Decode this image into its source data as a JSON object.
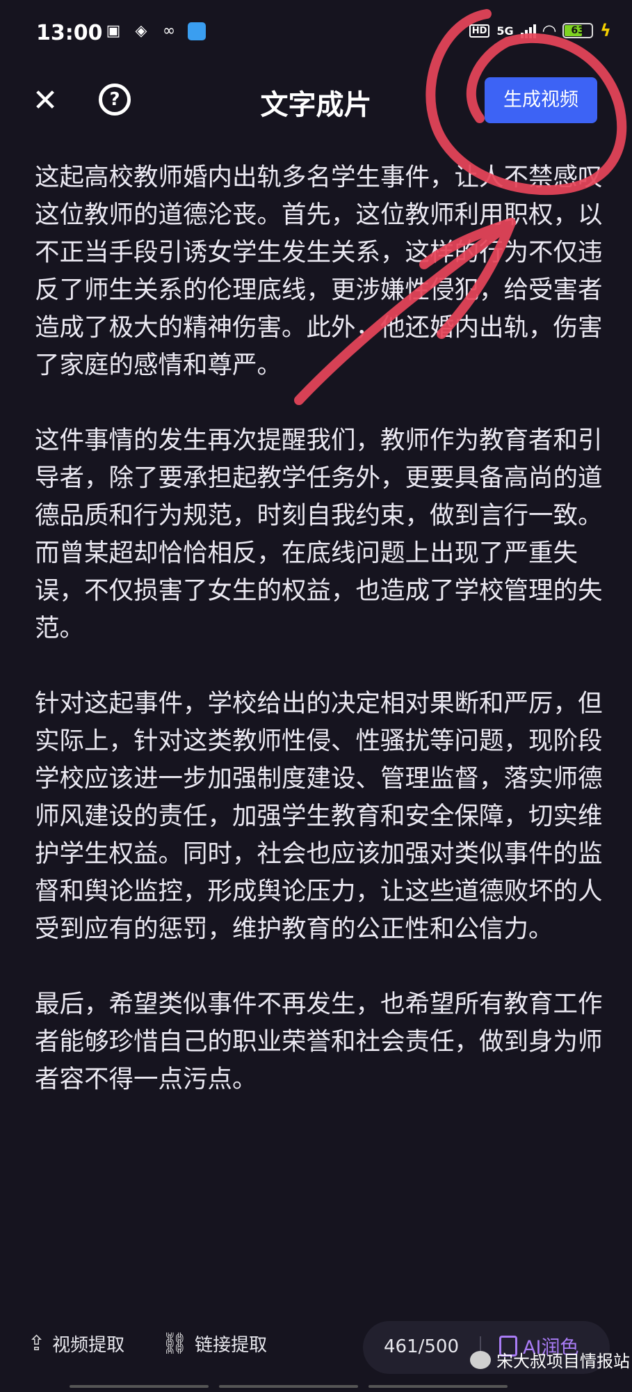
{
  "status_bar": {
    "time": "13:00",
    "network": "5G",
    "battery": "63",
    "icons": [
      "tv-icon",
      "cloud-app-icon",
      "butterfly-icon",
      "wallet-icon",
      "hd-icon",
      "signal-icon",
      "wifi-icon",
      "battery-icon",
      "charging-icon"
    ]
  },
  "header": {
    "close_icon": "close-icon",
    "help_icon": "help-circle-icon",
    "title": "文字成片",
    "generate_button": "生成视频"
  },
  "content": {
    "paragraphs": [
      "这起高校教师婚内出轨多名学生事件，让人不禁感叹这位教师的道德沦丧。首先，这位教师利用职权，以不正当手段引诱女学生发生关系，这样的行为不仅违反了师生关系的伦理底线，更涉嫌性侵犯，给受害者造成了极大的精神伤害。此外，他还婚内出轨，伤害了家庭的感情和尊严。",
      "这件事情的发生再次提醒我们，教师作为教育者和引导者，除了要承担起教学任务外，更要具备高尚的道德品质和行为规范，时刻自我约束，做到言行一致。而曾某超却恰恰相反，在底线问题上出现了严重失误，不仅损害了女生的权益，也造成了学校管理的失范。",
      "针对这起事件，学校给出的决定相对果断和严厉，但实际上，针对这类教师性侵、性骚扰等问题，现阶段学校应该进一步加强制度建设、管理监督，落实师德师风建设的责任，加强学生教育和安全保障，切实维护学生权益。同时，社会也应该加强对类似事件的监督和舆论监控，形成舆论压力，让这些道德败坏的人受到应有的惩罚，维护教育的公正性和公信力。",
      "最后，希望类似事件不再发生，也希望所有教育工作者能够珍惜自己的职业荣誉和社会责任，做到身为师者容不得一点污点。"
    ]
  },
  "bottom_bar": {
    "video_extract": "视频提取",
    "link_extract": "链接提取",
    "counter": "461/500",
    "ai_polish": "AI润色",
    "watermark": "宋大叔项目情报站"
  },
  "colors": {
    "background": "#16141f",
    "accent_button": "#3d63f5",
    "annotation": "#e8455a",
    "ai_purple": "#a97cf5"
  }
}
